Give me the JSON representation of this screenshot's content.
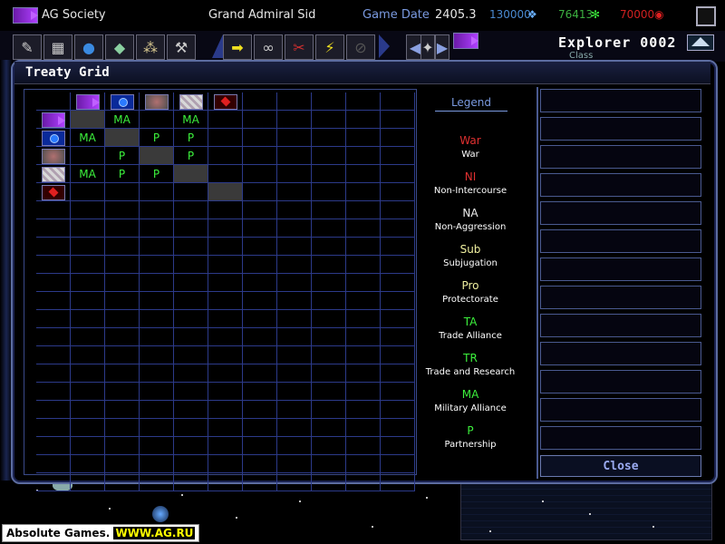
{
  "topbar": {
    "society": "AG Society",
    "admiral": "Grand Admiral Sid",
    "game_date_label": "Game Date",
    "game_date": "2405.3",
    "res1": "130000",
    "res2": "76413",
    "res3": "70000"
  },
  "ship": {
    "name": "Explorer 0002",
    "class_label": "Class"
  },
  "dialog": {
    "title": "Treaty Grid",
    "close": "Close"
  },
  "grid": {
    "rows": [
      [
        "",
        "MA",
        "",
        "MA",
        ""
      ],
      [
        "MA",
        "",
        "P",
        "P",
        ""
      ],
      [
        "",
        "P",
        "",
        "P",
        ""
      ],
      [
        "MA",
        "P",
        "P",
        "",
        ""
      ],
      [
        "",
        "",
        "",
        "",
        ""
      ]
    ]
  },
  "legend": {
    "title": "Legend",
    "items": [
      {
        "code": "War",
        "name": "War",
        "color": "#e03030"
      },
      {
        "code": "NI",
        "name": "Non-Intercourse",
        "color": "#e03030"
      },
      {
        "code": "NA",
        "name": "Non-Aggression",
        "color": "#f0f0f0"
      },
      {
        "code": "Sub",
        "name": "Subjugation",
        "color": "#f0f0a0"
      },
      {
        "code": "Pro",
        "name": "Protectorate",
        "color": "#f0f0a0"
      },
      {
        "code": "TA",
        "name": "Trade Alliance",
        "color": "#3cf03c"
      },
      {
        "code": "TR",
        "name": "Trade and Research",
        "color": "#3cf03c"
      },
      {
        "code": "MA",
        "name": "Military Alliance",
        "color": "#3cf03c"
      },
      {
        "code": "P",
        "name": "Partnership",
        "color": "#3cf03c"
      }
    ]
  },
  "badge": {
    "prefix": "Absolute Games.",
    "site": "WWW.AG.RU"
  },
  "icons": [
    "bomb-icon",
    "missile-icon",
    "planet-icon",
    "shield-icon",
    "fleet-icon",
    "wrench-icon",
    "arrow-right-icon",
    "handcuffs-icon",
    "weapon-icon",
    "lightning-icon",
    "no-icon"
  ]
}
